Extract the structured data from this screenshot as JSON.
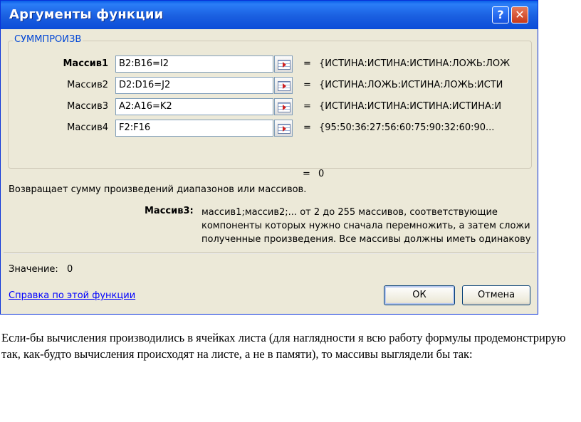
{
  "dialog": {
    "title": "Аргументы функции",
    "help_glyph": "?",
    "close_glyph": "✕",
    "function_name": "СУММПРОИЗВ",
    "arguments": [
      {
        "label": "Массив1",
        "value": "B2:B16=I2",
        "result": "{ИСТИНА:ИСТИНА:ИСТИНА:ЛОЖЬ:ЛОЖ"
      },
      {
        "label": "Массив2",
        "value": "D2:D16=J2",
        "result": "{ИСТИНА:ЛОЖЬ:ИСТИНА:ЛОЖЬ:ИСТИ"
      },
      {
        "label": "Массив3",
        "value": "A2:A16=K2",
        "result": "{ИСТИНА:ИСТИНА:ИСТИНА:ИСТИНА:И"
      },
      {
        "label": "Массив4",
        "value": "F2:F16",
        "result": "{95:50:36:27:56:60:75:90:32:60:90..."
      }
    ],
    "equals": "=",
    "formula_result": "0",
    "description": "Возвращает сумму произведений диапазонов или массивов.",
    "arg_desc_name": "Массив3:",
    "arg_desc_lines": [
      "массив1;массив2;... от 2 до 255 массивов, соответствующие",
      "компоненты которых нужно сначала перемножить, а затем сложить",
      "полученные произведения. Все массивы должны иметь одинаковую"
    ],
    "value_label": "Значение:",
    "value": "0",
    "help_link": "Справка по этой функции",
    "ok_label": "ОК",
    "cancel_label": "Отмена"
  },
  "caption": "Если-бы вычисления производились в ячейках листа (для наглядности я всю работу формулы продемонстрирую так, как-будто вычисления происходят на листе, а не в памяти), то массивы выглядели бы так:"
}
